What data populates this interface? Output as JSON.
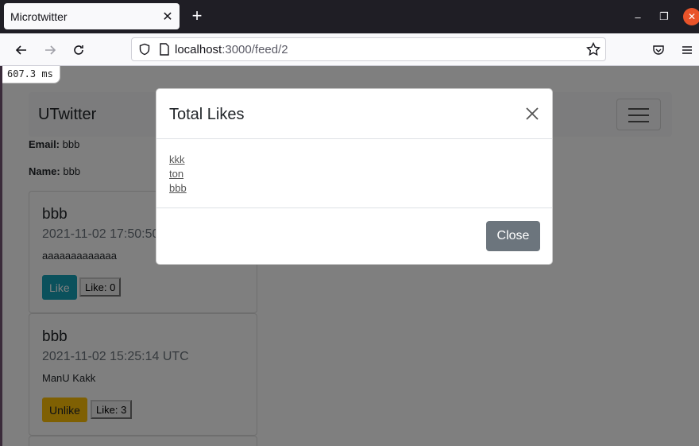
{
  "browser": {
    "tab_title": "Microtwitter",
    "url_host": "localhost",
    "url_path": ":3000/feed/2"
  },
  "page": {
    "timing": "607.3 ms",
    "brand": "UTwitter",
    "email_label": "Email:",
    "email_value": "bbb",
    "name_label": "Name:",
    "name_value": "bbb",
    "posts": [
      {
        "author": "bbb",
        "date": "2021-11-02 17:50:50",
        "body": "aaaaaaaaaaaaa",
        "action": "Like",
        "count": "Like: 0",
        "action_color": "#17a2b8"
      },
      {
        "author": "bbb",
        "date": "2021-11-02 15:25:14 UTC",
        "body": "ManU Kakk",
        "action": "Unlike",
        "count": "Like: 3",
        "action_color": "#ffc107"
      }
    ]
  },
  "modal": {
    "title": "Total Likes",
    "likers": [
      "kkk",
      "ton",
      "bbb"
    ],
    "close_label": "Close"
  }
}
